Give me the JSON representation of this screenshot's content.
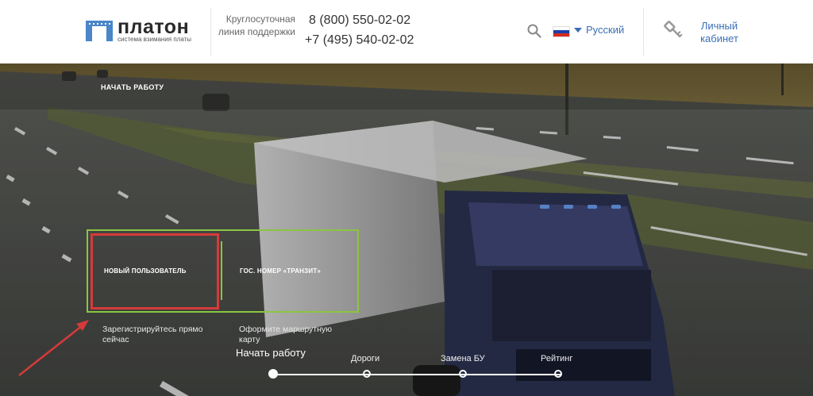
{
  "header": {
    "logo": {
      "title": "платон",
      "subtitle": "система взимания платы"
    },
    "support": {
      "label": "Круглосуточная линия поддержки",
      "phone_1": "8 (800) 550-02-02",
      "phone_2": "+7 (495) 540-02-02"
    },
    "language": {
      "selected": "Русский",
      "flag": "ru-flag-icon"
    },
    "search_icon": "search-icon",
    "cabinet": {
      "label": "Личный кабинет",
      "icon": "key-icon"
    }
  },
  "hero": {
    "breadcrumb": "НАЧАТЬ РАБОТУ",
    "options": [
      {
        "label": "НОВЫЙ ПОЛЬЗОВАТЕЛЬ",
        "description": "Зарегистрируйтесь прямо сейчас"
      },
      {
        "label": "ГОС. НОМЕР «ТРАНЗИТ»",
        "description": "Оформите маршрутную карту"
      }
    ],
    "steps": [
      {
        "label": "Начать работу",
        "active": true
      },
      {
        "label": "Дороги",
        "active": false
      },
      {
        "label": "Замена БУ",
        "active": false
      },
      {
        "label": "Рейтинг",
        "active": false
      }
    ]
  },
  "colors": {
    "accent_blue": "#3a6fb7",
    "green_frame": "#8bc53f",
    "highlight_red": "#d63a3a"
  }
}
